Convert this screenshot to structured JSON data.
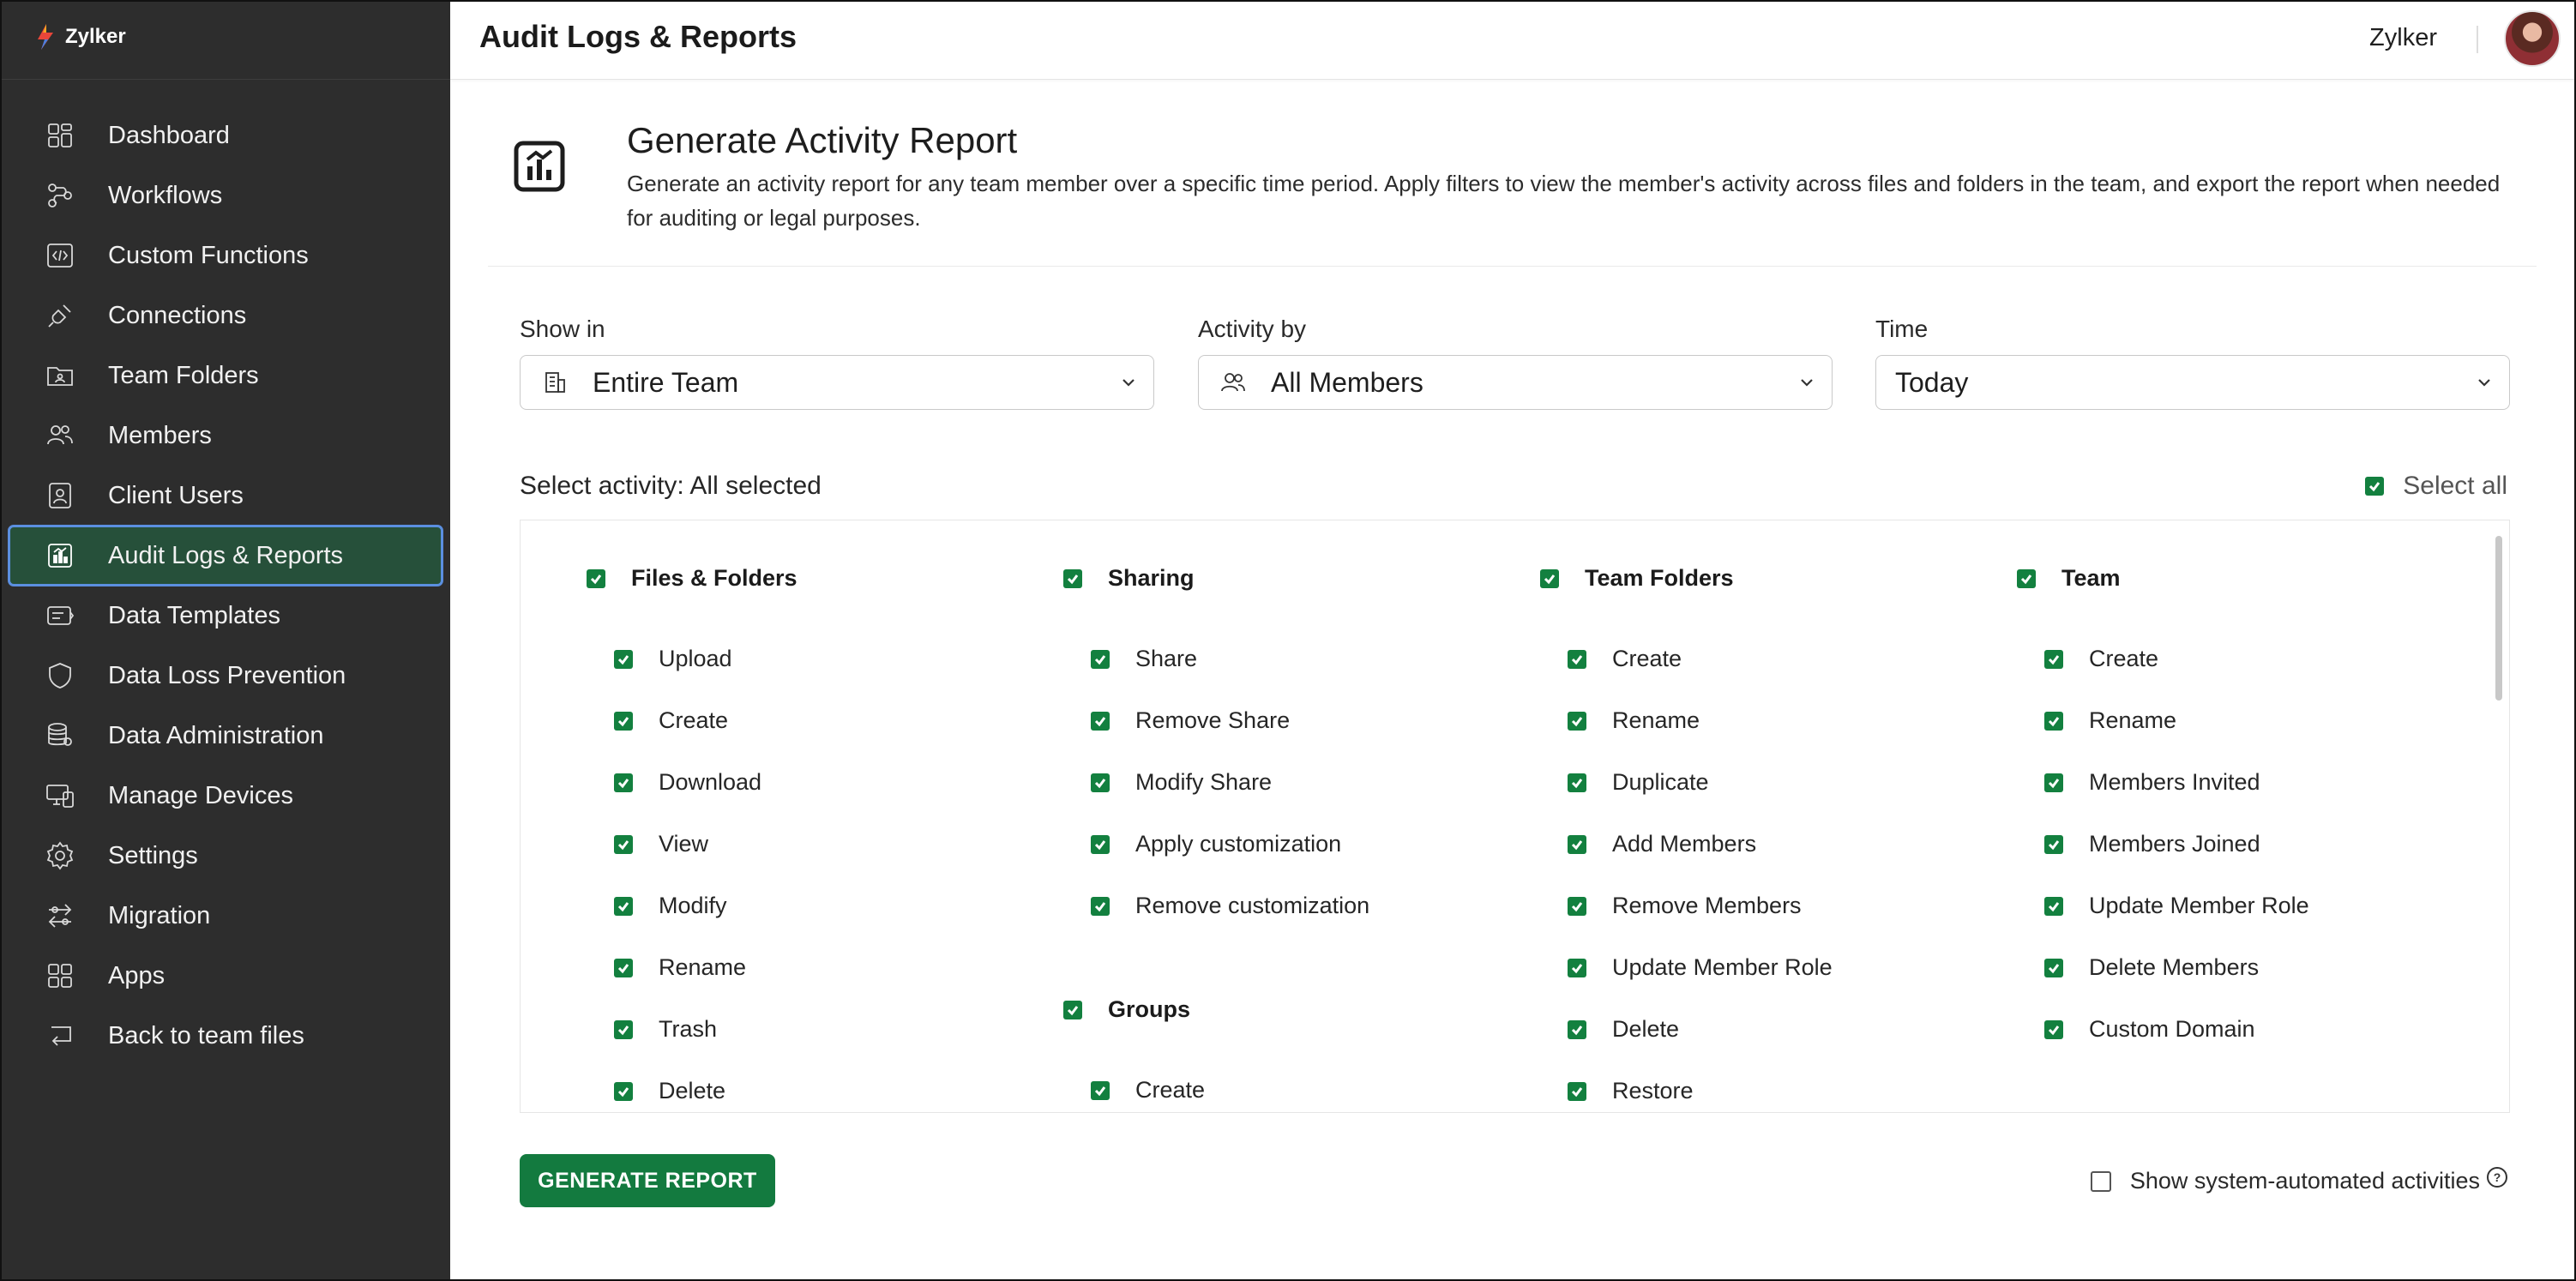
{
  "brand": {
    "name": "Zylker"
  },
  "sidebar": {
    "items": [
      {
        "label": "Dashboard",
        "icon": "dashboard-icon",
        "active": false
      },
      {
        "label": "Workflows",
        "icon": "workflows-icon",
        "active": false
      },
      {
        "label": "Custom Functions",
        "icon": "code-icon",
        "active": false
      },
      {
        "label": "Connections",
        "icon": "plug-icon",
        "active": false
      },
      {
        "label": "Team Folders",
        "icon": "team-folder-icon",
        "active": false
      },
      {
        "label": "Members",
        "icon": "members-icon",
        "active": false
      },
      {
        "label": "Client Users",
        "icon": "client-user-icon",
        "active": false
      },
      {
        "label": "Audit Logs & Reports",
        "icon": "report-icon",
        "active": true
      },
      {
        "label": "Data Templates",
        "icon": "data-template-icon",
        "active": false
      },
      {
        "label": "Data Loss Prevention",
        "icon": "shield-icon",
        "active": false
      },
      {
        "label": "Data Administration",
        "icon": "database-icon",
        "active": false
      },
      {
        "label": "Manage Devices",
        "icon": "devices-icon",
        "active": false
      },
      {
        "label": "Settings",
        "icon": "gear-icon",
        "active": false
      },
      {
        "label": "Migration",
        "icon": "migration-icon",
        "active": false
      },
      {
        "label": "Apps",
        "icon": "apps-icon",
        "active": false
      },
      {
        "label": "Back to team files",
        "icon": "back-icon",
        "active": false
      }
    ]
  },
  "header": {
    "title": "Audit Logs & Reports",
    "org_name": "Zylker"
  },
  "report": {
    "title": "Generate Activity Report",
    "description": "Generate an activity report for any team member over a specific time period. Apply filters to view the member's activity across files and folders in the team, and export the report when needed for auditing or legal purposes."
  },
  "filters": {
    "show_in": {
      "label": "Show in",
      "value": "Entire Team"
    },
    "activity_by": {
      "label": "Activity by",
      "value": "All Members"
    },
    "time": {
      "label": "Time",
      "value": "Today"
    }
  },
  "activity": {
    "label": "Select activity: All selected",
    "select_all_label": "Select all",
    "groups": [
      {
        "title": "Files & Folders",
        "items": [
          "Upload",
          "Create",
          "Download",
          "View",
          "Modify",
          "Rename",
          "Trash",
          "Delete"
        ]
      },
      {
        "title": "Sharing",
        "items": [
          "Share",
          "Remove Share",
          "Modify Share",
          "Apply customization",
          "Remove customization"
        ]
      },
      {
        "title": "Groups",
        "items": [
          "Create"
        ]
      },
      {
        "title": "Team Folders",
        "items": [
          "Create",
          "Rename",
          "Duplicate",
          "Add Members",
          "Remove Members",
          "Update Member Role",
          "Delete",
          "Restore"
        ]
      },
      {
        "title": "Team",
        "items": [
          "Create",
          "Rename",
          "Members Invited",
          "Members Joined",
          "Update Member Role",
          "Delete Members",
          "Custom Domain"
        ]
      }
    ]
  },
  "footer": {
    "generate_button": "GENERATE REPORT",
    "system_automated_label": "Show system-automated activities"
  },
  "colors": {
    "sidebar_bg": "#2d2d2d",
    "active_bg": "#26503a",
    "accent_green": "#137a3f"
  }
}
